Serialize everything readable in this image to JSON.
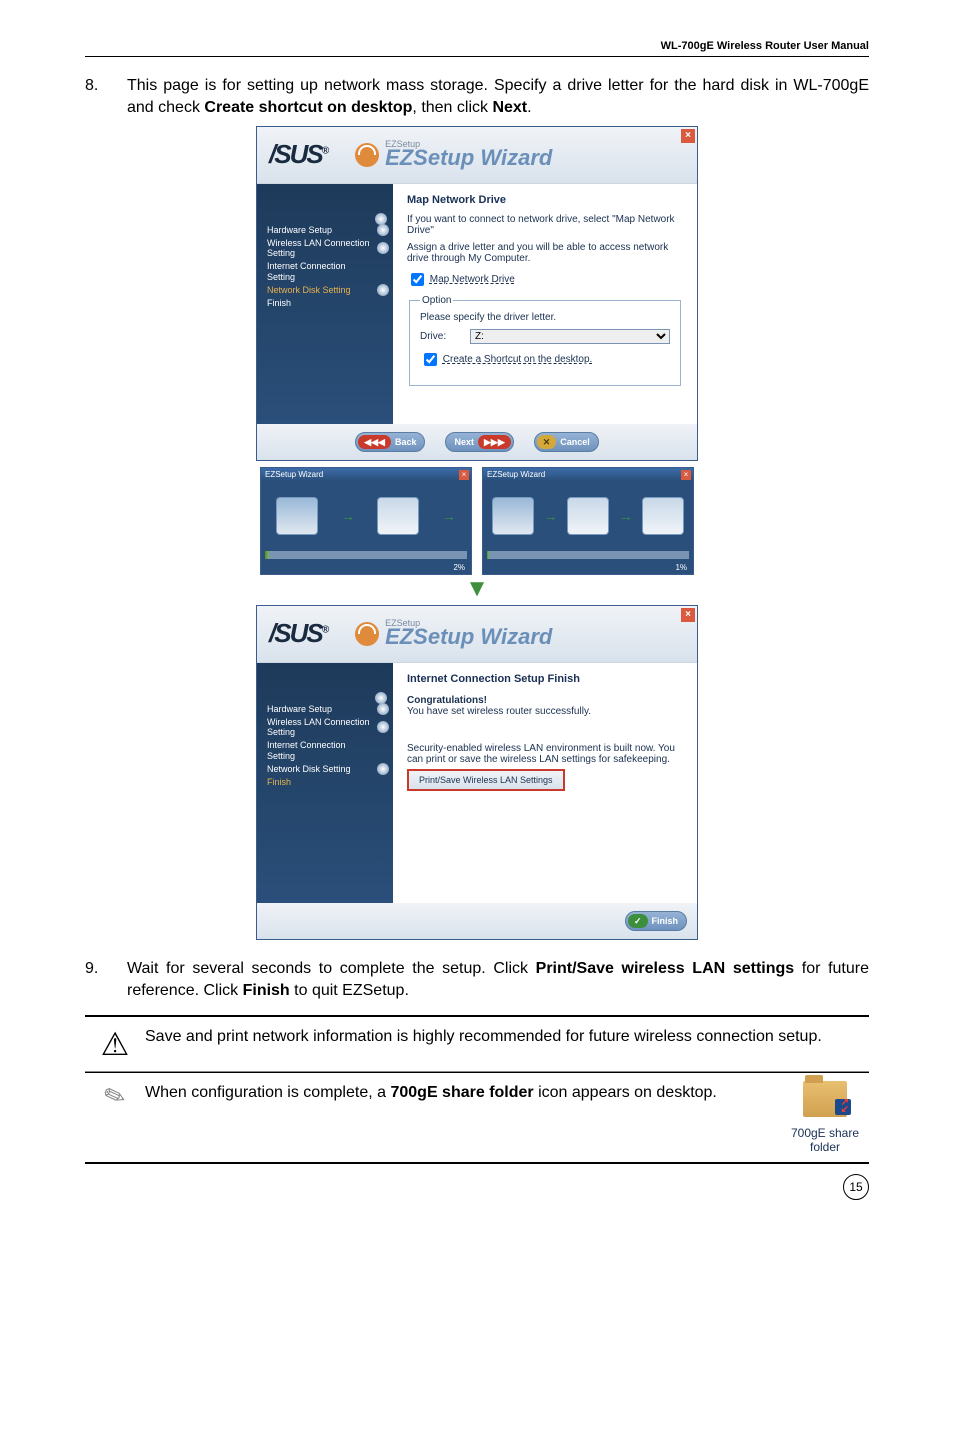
{
  "header": {
    "manual_title": "WL-700gE Wireless Router User Manual"
  },
  "step8": {
    "num": "8.",
    "text_parts": [
      "This page is for setting up network mass storage. Specify a drive letter for the hard disk in WL-700gE and check ",
      "Create shortcut on desktop",
      ", then click ",
      "Next",
      "."
    ]
  },
  "ez_brand": {
    "logo": "/SUS",
    "reg": "®",
    "small": "EZSetup",
    "title": "EZSetup Wizard"
  },
  "sidebar": {
    "items": [
      {
        "label": "Hardware Setup"
      },
      {
        "label": "Wireless LAN Connection Setting"
      },
      {
        "label": "Internet Connection Setting"
      },
      {
        "label": "Network Disk Setting"
      },
      {
        "label": "Finish"
      }
    ]
  },
  "wiz1": {
    "title": "Map Network Drive",
    "intro1": "If you want to connect to network drive, select \"Map Network Drive\"",
    "intro2": "Assign a drive letter and you will be able to access network drive through My Computer.",
    "check_map": "Map Network Drive",
    "option_legend": "Option",
    "option_text": "Please specify the driver letter.",
    "drive_label": "Drive:",
    "drive_value": "Z:",
    "check_shortcut": "Create a Shortcut on the desktop.",
    "btn_back": "Back",
    "btn_next": "Next",
    "btn_cancel": "Cancel"
  },
  "mini": {
    "title": "EZSetup Wizard",
    "pct1": "2%",
    "pct2": "1%"
  },
  "wiz2": {
    "title": "Internet Connection Setup Finish",
    "congrats": "Congratulations!",
    "success": "You have set wireless router successfully.",
    "envtext": "Security-enabled wireless LAN environment is built now. You can print or save the wireless LAN settings for safekeeping.",
    "print_btn": "Print/Save Wireless LAN Settings",
    "btn_finish": "Finish"
  },
  "step9": {
    "num": "9.",
    "text_parts": [
      "Wait for several seconds to complete the setup. Click ",
      "Print/Save wireless LAN settings",
      " for future reference. Click ",
      "Finish",
      " to quit EZSetup."
    ]
  },
  "note1": "Save and print network information is highly recommended for future wireless connection setup.",
  "note2_parts": [
    "When configuration is complete, a ",
    "700gE share folder",
    " icon appears on desktop."
  ],
  "folder": {
    "label": "700gE share folder"
  },
  "page_num": "15"
}
